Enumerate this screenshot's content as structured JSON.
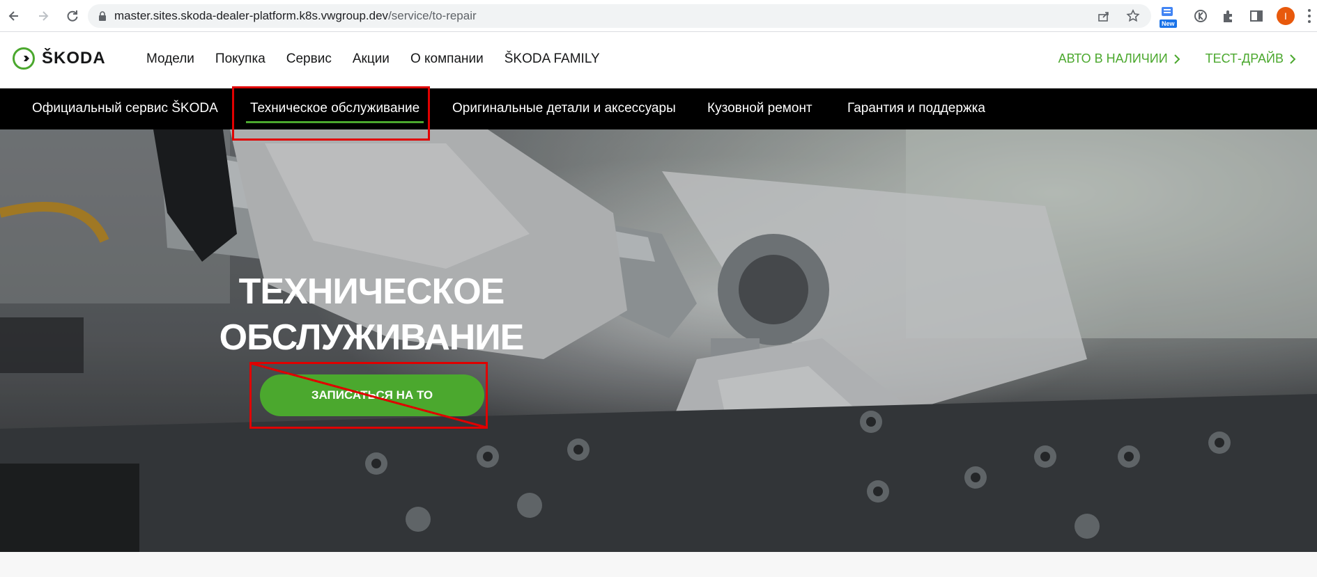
{
  "browser": {
    "url_host": "master.sites.skoda-dealer-platform.k8s.vwgroup.dev",
    "url_path": "/service/to-repair",
    "extension_badge": "New",
    "profile_initial": "I"
  },
  "header": {
    "logo_text": "ŠKODA",
    "nav": [
      "Модели",
      "Покупка",
      "Сервис",
      "Акции",
      "О компании",
      "ŠKODA FAMILY"
    ],
    "cta": [
      "АВТО В НАЛИЧИИ",
      "ТЕСТ-ДРАЙВ"
    ]
  },
  "sub_nav": {
    "items": [
      "Официальный сервис ŠKODA",
      "Техническое обслуживание",
      "Оригинальные детали и аксессуары",
      "Кузовной ремонт",
      "Гарантия и поддержка"
    ],
    "active_index": 1
  },
  "hero": {
    "title_line1": "ТЕХНИЧЕСКОЕ",
    "title_line2": "ОБСЛУЖИВАНИЕ",
    "button_label": "ЗАПИСАТЬСЯ НА ТО"
  },
  "colors": {
    "brand_green": "#4ba82e",
    "annotation_red": "#e00000"
  }
}
